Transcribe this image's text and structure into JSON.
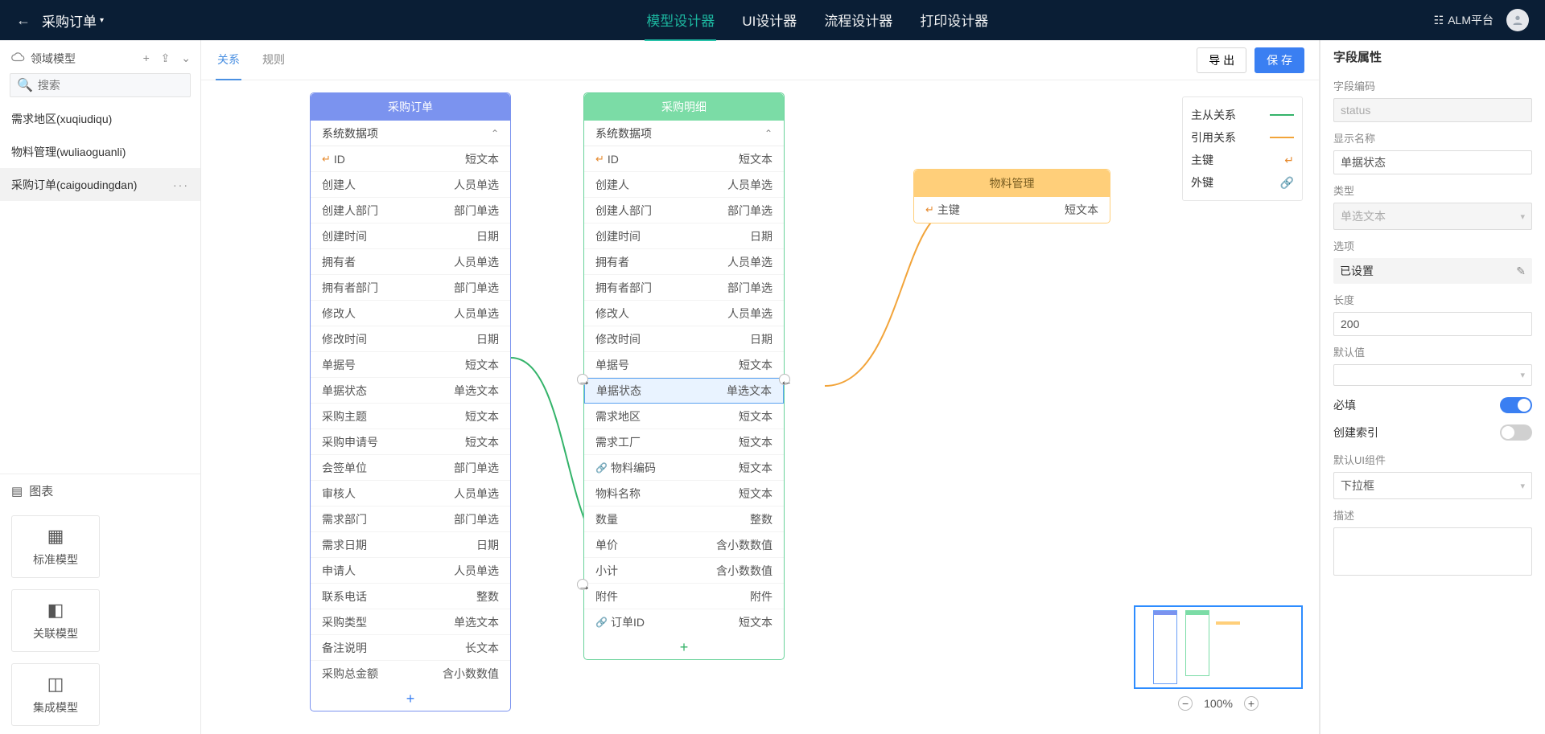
{
  "header": {
    "title": "采购订单",
    "tabs": [
      "模型设计器",
      "UI设计器",
      "流程设计器",
      "打印设计器"
    ],
    "activeTab": 0,
    "platform": "ALM平台"
  },
  "sidebar": {
    "label": "领域模型",
    "searchPlaceholder": "搜索",
    "items": [
      {
        "label": "需求地区(xuqiudiqu)"
      },
      {
        "label": "物料管理(wuliaoguanli)"
      },
      {
        "label": "采购订单(caigoudingdan)",
        "active": true
      }
    ],
    "sectionLabel": "图表",
    "cards": [
      "标准模型",
      "关联模型",
      "集成模型"
    ]
  },
  "centerTabs": {
    "items": [
      "关系",
      "规则"
    ],
    "active": 0
  },
  "actions": {
    "export": "导 出",
    "save": "保 存"
  },
  "entities": {
    "blue": {
      "title": "采购订单",
      "section": "系统数据项",
      "rows": [
        {
          "k": "ID",
          "v": "短文本",
          "pk": true
        },
        {
          "k": "创建人",
          "v": "人员单选"
        },
        {
          "k": "创建人部门",
          "v": "部门单选"
        },
        {
          "k": "创建时间",
          "v": "日期"
        },
        {
          "k": "拥有者",
          "v": "人员单选"
        },
        {
          "k": "拥有者部门",
          "v": "部门单选"
        },
        {
          "k": "修改人",
          "v": "人员单选"
        },
        {
          "k": "修改时间",
          "v": "日期"
        },
        {
          "k": "单据号",
          "v": "短文本"
        },
        {
          "k": "单据状态",
          "v": "单选文本"
        },
        {
          "k": "采购主题",
          "v": "短文本"
        },
        {
          "k": "采购申请号",
          "v": "短文本"
        },
        {
          "k": "会签单位",
          "v": "部门单选"
        },
        {
          "k": "审核人",
          "v": "人员单选"
        },
        {
          "k": "需求部门",
          "v": "部门单选"
        },
        {
          "k": "需求日期",
          "v": "日期"
        },
        {
          "k": "申请人",
          "v": "人员单选"
        },
        {
          "k": "联系电话",
          "v": "整数"
        },
        {
          "k": "采购类型",
          "v": "单选文本"
        },
        {
          "k": "备注说明",
          "v": "长文本"
        },
        {
          "k": "采购总金额",
          "v": "含小数数值"
        }
      ]
    },
    "green": {
      "title": "采购明细",
      "section": "系统数据项",
      "rows": [
        {
          "k": "ID",
          "v": "短文本",
          "pk": true
        },
        {
          "k": "创建人",
          "v": "人员单选"
        },
        {
          "k": "创建人部门",
          "v": "部门单选"
        },
        {
          "k": "创建时间",
          "v": "日期"
        },
        {
          "k": "拥有者",
          "v": "人员单选"
        },
        {
          "k": "拥有者部门",
          "v": "部门单选"
        },
        {
          "k": "修改人",
          "v": "人员单选"
        },
        {
          "k": "修改时间",
          "v": "日期"
        },
        {
          "k": "单据号",
          "v": "短文本"
        },
        {
          "k": "单据状态",
          "v": "单选文本",
          "sel": true
        },
        {
          "k": "需求地区",
          "v": "短文本"
        },
        {
          "k": "需求工厂",
          "v": "短文本"
        },
        {
          "k": "物料编码",
          "v": "短文本",
          "fk": true
        },
        {
          "k": "物料名称",
          "v": "短文本"
        },
        {
          "k": "数量",
          "v": "整数"
        },
        {
          "k": "单价",
          "v": "含小数数值"
        },
        {
          "k": "小计",
          "v": "含小数数值"
        },
        {
          "k": "附件",
          "v": "附件"
        },
        {
          "k": "订单ID",
          "v": "短文本",
          "fk": true
        }
      ]
    },
    "orange": {
      "title": "物料管理",
      "rows": [
        {
          "k": "主键",
          "v": "短文本",
          "pk": true
        }
      ]
    }
  },
  "legend": {
    "master": "主从关系",
    "ref": "引用关系",
    "pk": "主键",
    "fk": "外键"
  },
  "zoom": "100%",
  "rpanel": {
    "title": "字段属性",
    "fieldCodeLabel": "字段编码",
    "fieldCode": "status",
    "displayNameLabel": "显示名称",
    "displayName": "单据状态",
    "typeLabel": "类型",
    "type": "单选文本",
    "optionsLabel": "选项",
    "options": "已设置",
    "lengthLabel": "长度",
    "length": "200",
    "defaultLabel": "默认值",
    "default": "",
    "requiredLabel": "必填",
    "indexLabel": "创建索引",
    "uiLabel": "默认UI组件",
    "ui": "下拉框",
    "descLabel": "描述"
  }
}
